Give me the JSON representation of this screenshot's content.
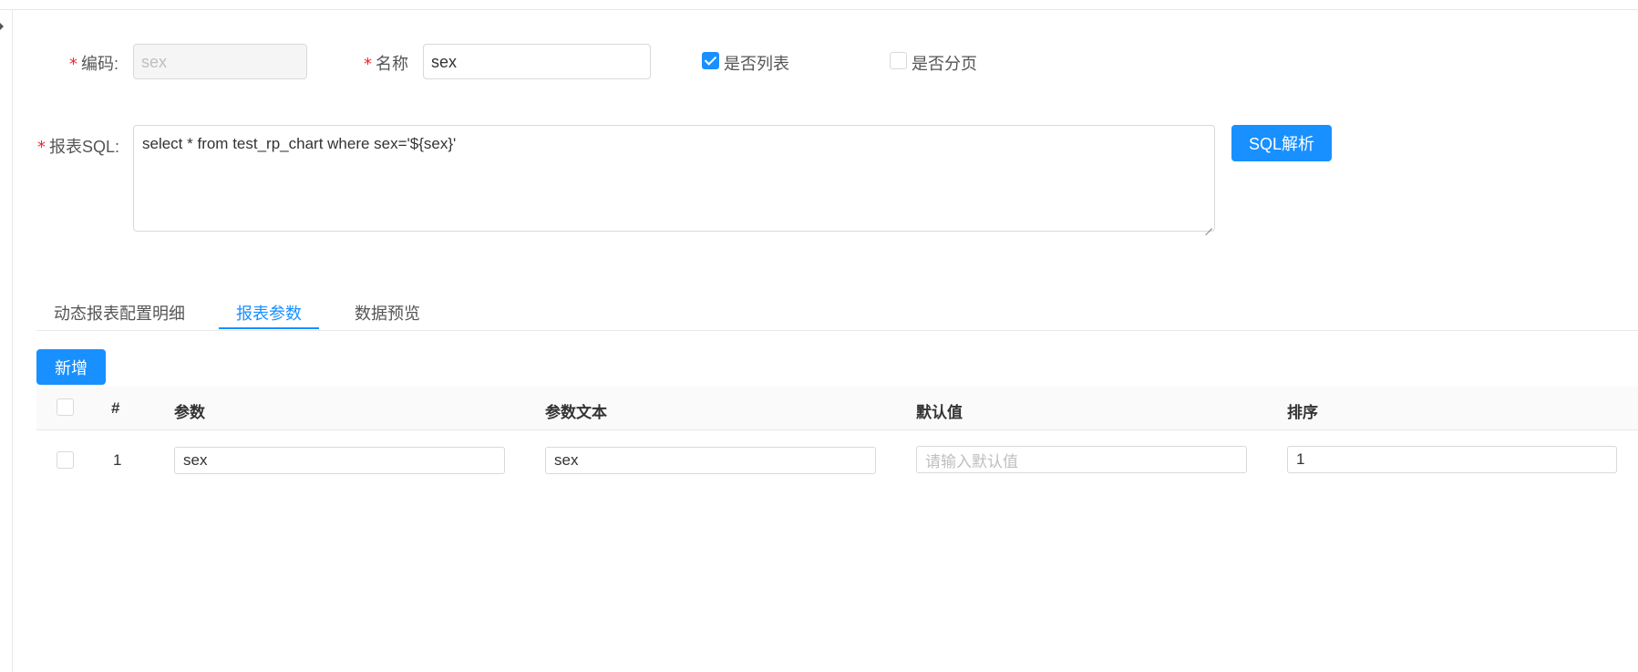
{
  "form": {
    "code": {
      "label": "编码:",
      "value": "sex"
    },
    "name": {
      "label": "名称",
      "value": "sex"
    },
    "is_list": {
      "label": "是否列表",
      "checked": true
    },
    "is_paged": {
      "label": "是否分页",
      "checked": false
    },
    "sql": {
      "label": "报表SQL:",
      "value": "select * from test_rp_chart where sex='${sex}'"
    },
    "required_mark": "*",
    "parse_button": "SQL解析"
  },
  "tabs": [
    {
      "label": "动态报表配置明细",
      "active": false
    },
    {
      "label": "报表参数",
      "active": true
    },
    {
      "label": "数据预览",
      "active": false
    }
  ],
  "toolbar": {
    "add_button": "新增"
  },
  "table": {
    "columns": [
      "#",
      "参数",
      "参数文本",
      "默认值",
      "排序"
    ],
    "rows": [
      {
        "index": "1",
        "param": "sex",
        "param_text": "sex",
        "default_placeholder": "请输入默认值",
        "default_value": "",
        "order": "1"
      }
    ]
  },
  "colors": {
    "primary": "#1890ff",
    "required": "#f5222d",
    "border": "#d9d9d9"
  }
}
